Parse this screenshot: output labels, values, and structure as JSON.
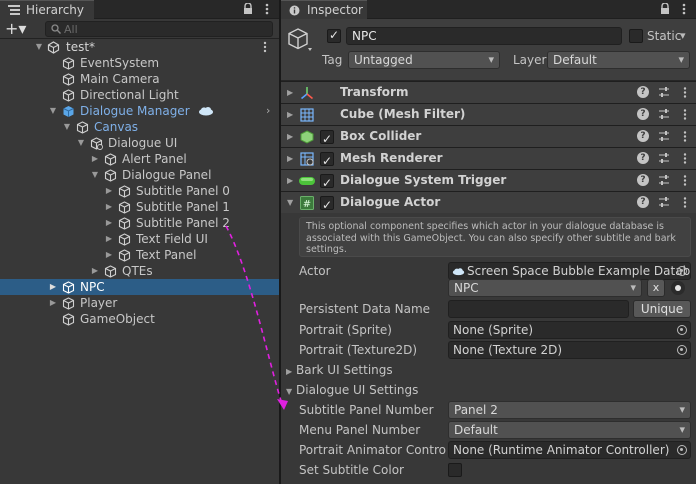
{
  "hierarchy": {
    "tab_label": "Hierarchy",
    "add_label": "+▾",
    "search_placeholder": "All",
    "rows": [
      {
        "label": "test*",
        "kind": "scene",
        "indent": 0,
        "arrow": "down",
        "icon": "unity-scene-icon"
      },
      {
        "label": "EventSystem",
        "kind": "obj",
        "indent": 2,
        "arrow": "",
        "icon": "cube-outline-icon"
      },
      {
        "label": "Main Camera",
        "kind": "obj",
        "indent": 2,
        "arrow": "",
        "icon": "cube-outline-icon"
      },
      {
        "label": "Directional Light",
        "kind": "obj",
        "indent": 2,
        "arrow": "",
        "icon": "cube-outline-icon"
      },
      {
        "label": "Dialogue Manager",
        "kind": "prefab",
        "indent": 2,
        "arrow": "down",
        "icon": "prefab-cube-icon"
      },
      {
        "label": "Canvas",
        "kind": "prefab-child",
        "indent": 3,
        "arrow": "down",
        "icon": "cube-outline-icon"
      },
      {
        "label": "Dialogue UI",
        "kind": "obj",
        "indent": 4,
        "arrow": "down",
        "icon": "cube-script-icon"
      },
      {
        "label": "Alert Panel",
        "kind": "obj",
        "indent": 5,
        "arrow": "right",
        "icon": "cube-outline-icon"
      },
      {
        "label": "Dialogue Panel",
        "kind": "obj",
        "indent": 5,
        "arrow": "down",
        "icon": "cube-outline-icon"
      },
      {
        "label": "Subtitle Panel 0",
        "kind": "obj",
        "indent": 6,
        "arrow": "right",
        "icon": "cube-outline-icon"
      },
      {
        "label": "Subtitle Panel 1",
        "kind": "obj",
        "indent": 6,
        "arrow": "right",
        "icon": "cube-outline-icon"
      },
      {
        "label": "Subtitle Panel 2",
        "kind": "obj",
        "indent": 6,
        "arrow": "right",
        "icon": "cube-outline-icon"
      },
      {
        "label": "Text Field UI",
        "kind": "obj",
        "indent": 6,
        "arrow": "right",
        "icon": "cube-outline-icon"
      },
      {
        "label": "Text Panel",
        "kind": "obj",
        "indent": 6,
        "arrow": "right",
        "icon": "cube-outline-icon"
      },
      {
        "label": "QTEs",
        "kind": "obj",
        "indent": 5,
        "arrow": "right",
        "icon": "cube-outline-icon"
      },
      {
        "label": "NPC",
        "kind": "selected",
        "indent": 2,
        "arrow": "right",
        "icon": "cube-outline-icon"
      },
      {
        "label": "Player",
        "kind": "obj",
        "indent": 2,
        "arrow": "right",
        "icon": "cube-outline-icon"
      },
      {
        "label": "GameObject",
        "kind": "obj",
        "indent": 2,
        "arrow": "",
        "icon": "cube-outline-icon"
      }
    ]
  },
  "inspector": {
    "tab_label": "Inspector",
    "object_name": "NPC",
    "static_label": "Static",
    "tag_label": "Tag",
    "tag_value": "Untagged",
    "layer_label": "Layer",
    "layer_value": "Default",
    "components": [
      {
        "name": "Transform",
        "icon": "transform-axes-icon",
        "has_checkbox": false,
        "expanded": false
      },
      {
        "name": "Cube (Mesh Filter)",
        "icon": "mesh-grid-icon",
        "has_checkbox": false,
        "expanded": false
      },
      {
        "name": "Box Collider",
        "icon": "box-collider-icon",
        "has_checkbox": true,
        "expanded": false
      },
      {
        "name": "Mesh Renderer",
        "icon": "mesh-renderer-icon",
        "has_checkbox": true,
        "expanded": false
      },
      {
        "name": "Dialogue System Trigger",
        "icon": "green-pill-icon",
        "has_checkbox": true,
        "expanded": false
      },
      {
        "name": "Dialogue Actor",
        "icon": "script-hash-icon",
        "has_checkbox": true,
        "expanded": true
      }
    ],
    "actor_info": "This optional component specifies which actor in your dialogue database is associated with this GameObject. You can also specify other subtitle and bark settings.",
    "actor_label": "Actor",
    "actor_database": "Screen Space Bubble Example Datab",
    "actor_value": "NPC",
    "actor_clear": "x",
    "persistent_label": "Persistent Data Name",
    "persistent_value": "",
    "unique_label": "Unique",
    "portrait_sprite_label": "Portrait (Sprite)",
    "portrait_sprite_value": "None (Sprite)",
    "portrait_tex_label": "Portrait (Texture2D)",
    "portrait_tex_value": "None (Texture 2D)",
    "bark_section": "Bark UI Settings",
    "dialogue_section": "Dialogue UI Settings",
    "subtitle_panel_label": "Subtitle Panel Number",
    "subtitle_panel_value": "Panel 2",
    "menu_panel_label": "Menu Panel Number",
    "menu_panel_value": "Default",
    "animator_label": "Portrait Animator Controlle",
    "animator_value": "None (Runtime Animator Controller)",
    "subtitle_color_label": "Set Subtitle Color",
    "subtitle_color_checked": false
  },
  "colors": {
    "selection": "#2c5d87",
    "prefab_text": "#7fb0e8",
    "annotation_arrow": "#e020e0"
  }
}
